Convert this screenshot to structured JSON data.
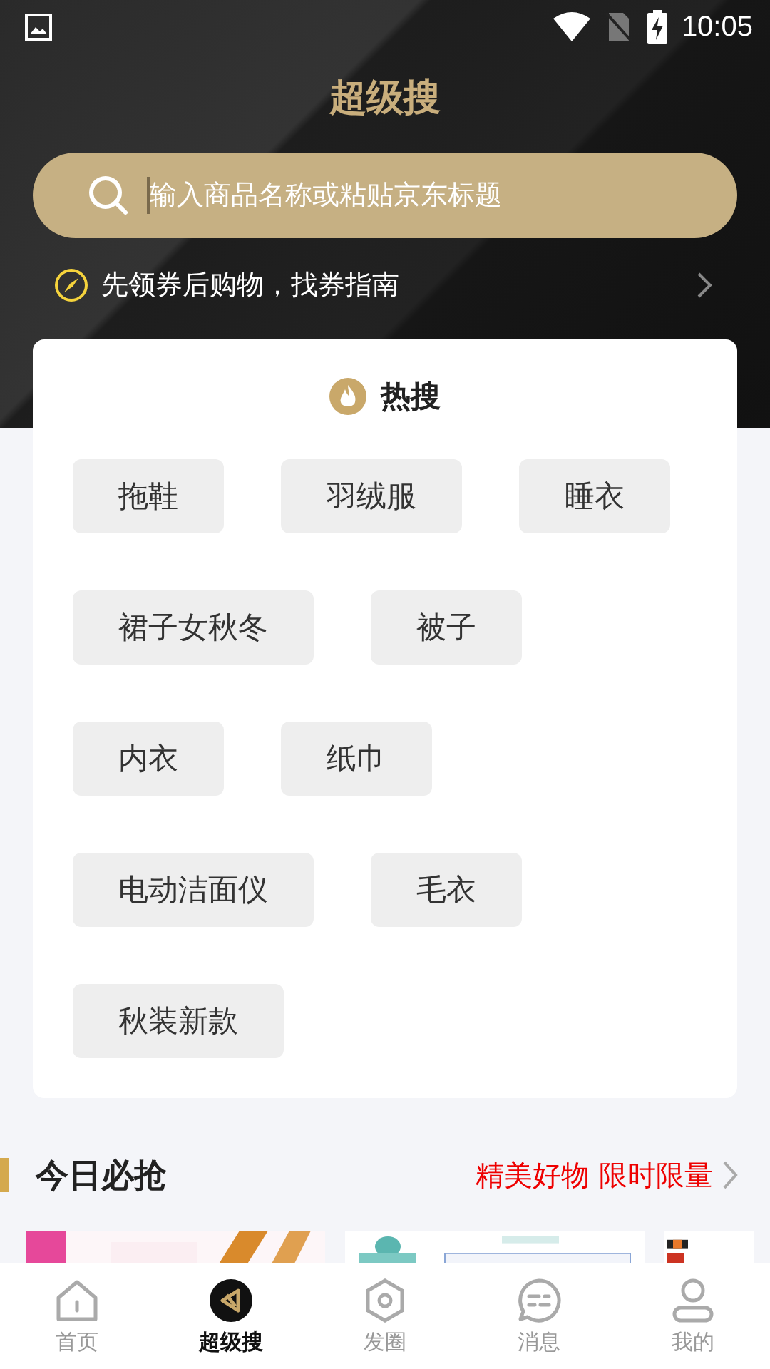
{
  "status_bar": {
    "time": "10:05"
  },
  "header": {
    "title": "超级搜"
  },
  "search": {
    "placeholder": "输入商品名称或粘贴京东标题"
  },
  "tip": {
    "text": "先领券后购物，找券指南"
  },
  "hot_search": {
    "title": "热搜",
    "tags": [
      "拖鞋",
      "羽绒服",
      "睡衣",
      "裙子女秋冬",
      "被子",
      "内衣",
      "纸巾",
      "电动洁面仪",
      "毛衣",
      "秋装新款"
    ]
  },
  "section": {
    "title": "今日必抢",
    "link": "精美好物 限时限量"
  },
  "tab_bar": [
    {
      "label": "首页",
      "selected": false
    },
    {
      "label": "超级搜",
      "selected": true
    },
    {
      "label": "发圈",
      "selected": false
    },
    {
      "label": "消息",
      "selected": false
    },
    {
      "label": "我的",
      "selected": false
    }
  ]
}
